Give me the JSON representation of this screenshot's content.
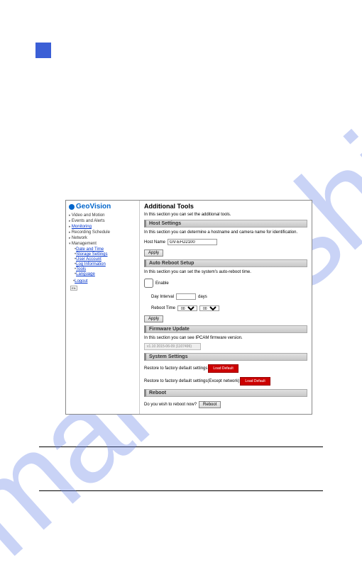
{
  "brand": "GeoVision",
  "nav": {
    "video_motion": "Video and Motion",
    "events_alerts": "Events and Alerts",
    "monitoring": "Monitoring",
    "recording_schedule": "Recording Schedule",
    "network": "Network",
    "management": "Management",
    "mgmt_items": {
      "date_time": "Date and Time",
      "storage": "Storage Settings",
      "user_account": "User Account",
      "log_info": "Log Information",
      "tools": "Tools",
      "language": "Language"
    },
    "logout": "Logout",
    "badge": "EN"
  },
  "main": {
    "title": "Additional Tools",
    "intro": "In this section you can set the additional tools."
  },
  "host": {
    "head": "Host Settings",
    "desc": "In this section you can determine a hostname and camera name for identification.",
    "label": "Host Name",
    "value": "GV-EFD2100",
    "apply": "Apply"
  },
  "reboot": {
    "head": "Auto Reboot Setup",
    "desc": "In this section you can set the system's auto-reboot time.",
    "enable": "Enable",
    "day_interval": "Day Interval",
    "days": "days",
    "reboot_time": "Reboot Time",
    "sel1": "00",
    "sel2": "00",
    "apply": "Apply"
  },
  "fw": {
    "head": "Firmware Update",
    "desc": "In this section you can see IPCAM firmware version.",
    "version": "v1.10 2015-06-09 (1107496)"
  },
  "sys": {
    "head": "System Settings",
    "row1": "Restore to factory default settings",
    "btn1": "Load Default",
    "row2": "Restore to factory default settings(Except network)",
    "btn2": "Load Default"
  },
  "boot": {
    "head": "Reboot",
    "q": "Do you wish to reboot now?",
    "btn": "Reboot"
  }
}
